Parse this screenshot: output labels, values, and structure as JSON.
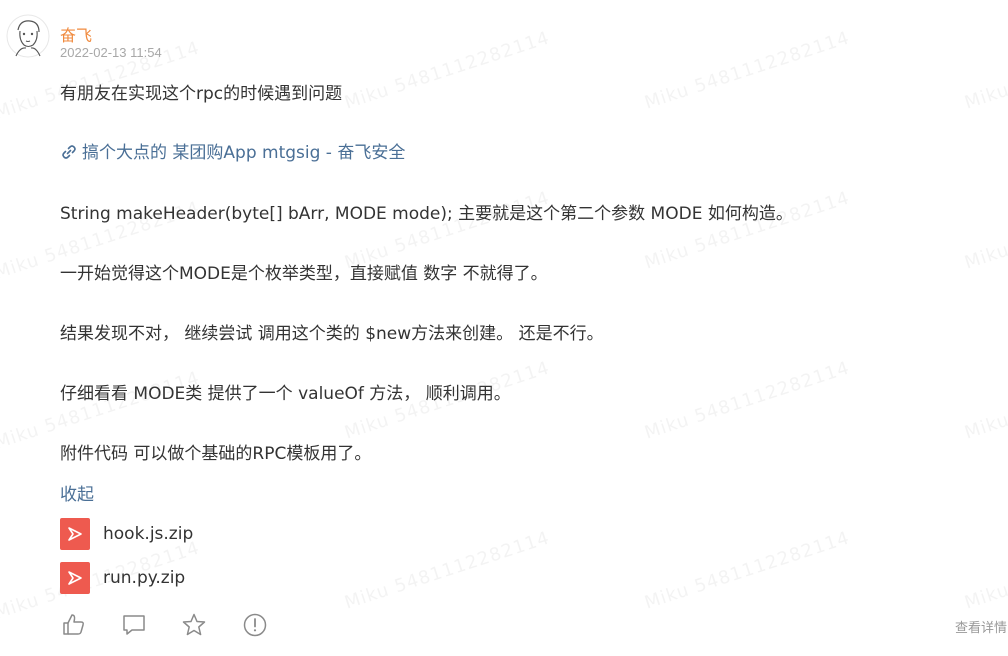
{
  "watermark": "Miku 5481112282114",
  "post": {
    "author": "奋飞",
    "date": "2022-02-13 11:54",
    "lines": [
      "有朋友在实现这个rpc的时候遇到问题",
      "String makeHeader(byte[] bArr, MODE mode);    主要就是这个第二个参数 MODE 如何构造。",
      "一开始觉得这个MODE是个枚举类型，直接赋值 数字 不就得了。",
      "结果发现不对，  继续尝试 调用这个类的 $new方法来创建。 还是不行。",
      "仔细看看 MODE类 提供了一个 valueOf 方法，  顺利调用。",
      "附件代码  可以做个基础的RPC模板用了。"
    ],
    "link_text": "搞个大点的 某团购App mtgsig - 奋飞安全",
    "collapse_label": "收起",
    "attachments": [
      {
        "name": "hook.js.zip",
        "icon": "file-zip-icon"
      },
      {
        "name": "run.py.zip",
        "icon": "file-zip-icon"
      }
    ],
    "details_label": "查看详情"
  },
  "actions": [
    "like-icon",
    "comment-icon",
    "star-icon",
    "report-icon"
  ],
  "colors": {
    "author": "#f08a3e",
    "link": "#4a6f96",
    "file_icon": "#ee5a4f",
    "muted": "#a8a8a8"
  }
}
